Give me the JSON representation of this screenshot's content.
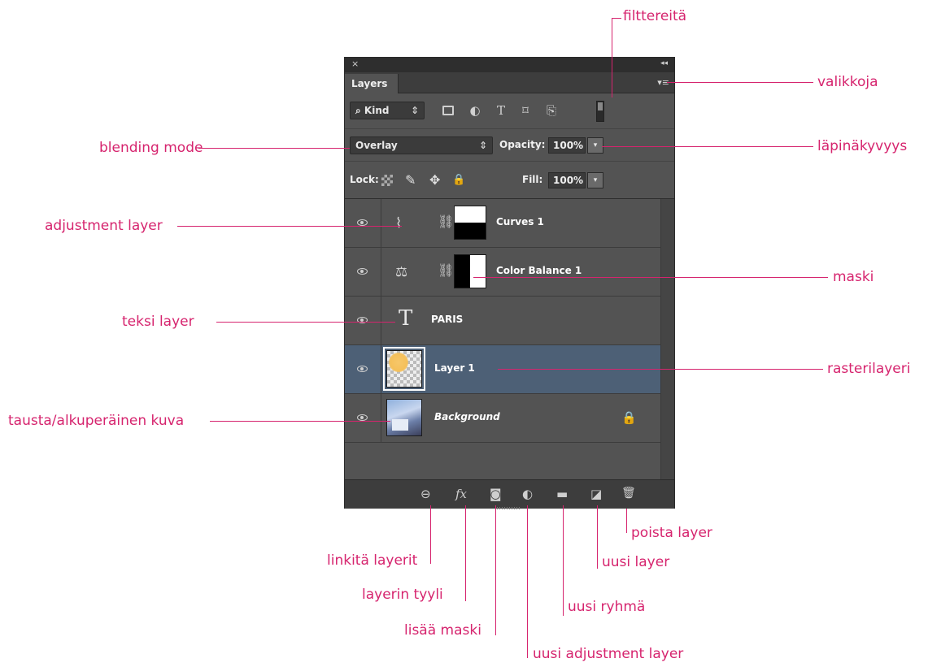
{
  "panel": {
    "close_glyph": "×",
    "collapse_glyph": "◂◂",
    "tab_label": "Layers",
    "menu_glyph": "▾≡",
    "filter": {
      "kind_icon": "search-icon",
      "kind_label": "Kind",
      "kind_arrow": "⇕",
      "icons": [
        "pixel-layer-filter-icon",
        "adjustment-layer-filter-icon",
        "type-layer-filter-icon",
        "shape-layer-filter-icon",
        "smart-object-filter-icon",
        "filter-toggle-icon"
      ],
      "T_glyph": "T",
      "shape_glyph": "⌑",
      "smart_glyph": "⎘",
      "adj_glyph": "◐"
    },
    "blend_mode": "Overlay",
    "blend_arrow": "⇕",
    "opacity_label": "Opacity:",
    "opacity_value": "100%",
    "lock_label": "Lock:",
    "fill_label": "Fill:",
    "fill_value": "100%",
    "dd_glyph": "▾",
    "lock_glyphs": {
      "brush": "✎",
      "move": "✥",
      "padlock": "🔒"
    }
  },
  "layers": [
    {
      "name": "Curves 1",
      "type": "adjustment",
      "icon": "curves-icon",
      "glyph": "⌇",
      "mask": "top-white-bottom-black"
    },
    {
      "name": "Color Balance 1",
      "type": "adjustment",
      "icon": "color-balance-icon",
      "glyph": "⚖",
      "mask": "left-black-right-white"
    },
    {
      "name": "PARIS",
      "type": "text",
      "glyph": "T"
    },
    {
      "name": "Layer 1",
      "type": "raster",
      "selected": true
    },
    {
      "name": "Background",
      "type": "background",
      "locked": true,
      "lock_glyph": "🔒"
    }
  ],
  "chain_glyph": "⛓",
  "bottom_icons": {
    "link": "⊖",
    "fx": "fx",
    "mask": "◙",
    "adjust": "◐",
    "group": "▬",
    "new": "◪",
    "trash": "🗑"
  },
  "annotations": {
    "filters": "filttereitä",
    "menus": "valikkoja",
    "blending_mode": "blending mode",
    "opacity": "läpinäkyvyys",
    "adjustment_layer": "adjustment layer",
    "mask": "maski",
    "text_layer": "teksi layer",
    "raster_layer": "rasterilayeri",
    "background": "tausta/alkuperäinen kuva",
    "delete_layer": "poista layer",
    "link_layers": "linkitä layerit",
    "new_layer": "uusi layer",
    "layer_style": "layerin tyyli",
    "new_group": "uusi ryhmä",
    "add_mask": "lisää maski",
    "new_adjustment_layer": "uusi adjustment layer"
  },
  "colors": {
    "annotation": "#d6246e",
    "panel_bg": "#535353",
    "selected_row": "#4d6076"
  }
}
